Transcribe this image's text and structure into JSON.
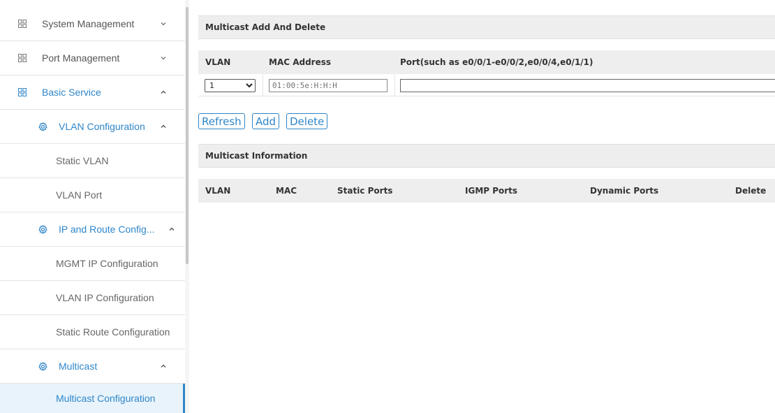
{
  "sidebar": {
    "items": [
      {
        "label": "System Management"
      },
      {
        "label": "Port Management"
      },
      {
        "label": "Basic Service"
      },
      {
        "label": "VLAN Configuration"
      },
      {
        "label": "Static VLAN"
      },
      {
        "label": "VLAN Port"
      },
      {
        "label": "IP and Route Config..."
      },
      {
        "label": "MGMT IP Configuration"
      },
      {
        "label": "VLAN IP Configuration"
      },
      {
        "label": "Static Route Configuration"
      },
      {
        "label": "Multicast"
      },
      {
        "label": "Multicast Configuration"
      }
    ]
  },
  "add_delete": {
    "title": "Multicast Add And Delete",
    "headers": {
      "vlan": "VLAN",
      "mac": "MAC Address",
      "port": "Port(such as e0/0/1-e0/0/2,e0/0/4,e0/1/1)"
    },
    "vlan_value": "1",
    "mac_placeholder": "01:00:5e:H:H:H",
    "port_value": ""
  },
  "buttons": {
    "refresh": "Refresh",
    "add": "Add",
    "delete": "Delete"
  },
  "info": {
    "title": "Multicast Information",
    "headers": {
      "vlan": "VLAN",
      "mac": "MAC",
      "static_ports": "Static Ports",
      "igmp_ports": "IGMP Ports",
      "dynamic_ports": "Dynamic Ports",
      "delete": "Delete"
    }
  },
  "colors": {
    "accent": "#2f86c8",
    "header_bg": "#eeeeee",
    "selected_bg": "#e8f3fb"
  }
}
